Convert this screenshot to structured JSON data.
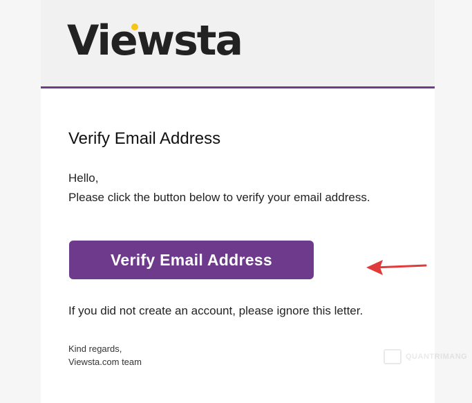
{
  "brand": {
    "logo_text": "Viewsta",
    "logo_dot_color": "#f5c518",
    "accent_color": "#6e3a8c"
  },
  "email": {
    "title": "Verify Email Address",
    "greeting": "Hello,",
    "instruction": "Please click the button below to verify your email address.",
    "button_label": "Verify Email Address",
    "button_color": "#6e3a8c",
    "ignore_note": "If you did not create an account, please ignore this letter.",
    "regards": "Kind regards,",
    "signature": "Viewsta.com team"
  },
  "annotation": {
    "arrow_icon": "red-arrow-left-icon",
    "arrow_color": "#e03a3a"
  },
  "watermark": {
    "text": "QUANTRIMANG"
  }
}
